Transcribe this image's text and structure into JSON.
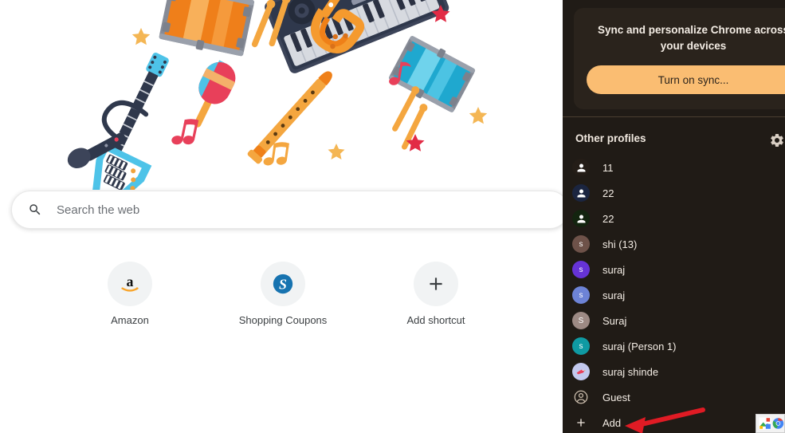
{
  "ntp": {
    "illustration_name": "musical-instruments-doodle",
    "search": {
      "placeholder": "Search the web",
      "value": "",
      "icon": "search-icon"
    },
    "shortcuts": [
      {
        "label": "Amazon",
        "icon": "amazon-icon"
      },
      {
        "label": "Shopping Coupons",
        "icon": "shopping-coupons-icon"
      },
      {
        "label": "Add shortcut",
        "icon": "plus-icon"
      }
    ]
  },
  "profile_panel": {
    "sync_card": {
      "title": "Sync and personalize Chrome across your devices",
      "button_label": "Turn on sync..."
    },
    "section_header": "Other profiles",
    "settings_icon": "gear-icon",
    "profiles": [
      {
        "name": "11",
        "initial": "",
        "avatar_type": "person-icon",
        "color": "#241d17"
      },
      {
        "name": "22",
        "initial": "",
        "avatar_type": "person-icon",
        "color": "#1b2540"
      },
      {
        "name": "22",
        "initial": "",
        "avatar_type": "person-icon",
        "color": "#13240f"
      },
      {
        "name": "shi (13)",
        "initial": "s",
        "avatar_type": "initial",
        "color": "#6e5249"
      },
      {
        "name": "suraj",
        "initial": "s",
        "avatar_type": "initial",
        "color": "#6633d6"
      },
      {
        "name": "suraj",
        "initial": "s",
        "avatar_type": "initial",
        "color": "#6d83d6"
      },
      {
        "name": "Suraj",
        "initial": "S",
        "avatar_type": "initial",
        "color": "#9d8a84"
      },
      {
        "name": "suraj (Person 1)",
        "initial": "s",
        "avatar_type": "initial",
        "color": "#0f9aa3"
      },
      {
        "name": "suraj shinde",
        "initial": "",
        "avatar_type": "bird-icon",
        "color": "#c3c9ee"
      },
      {
        "name": "Guest",
        "initial": "",
        "avatar_type": "guest-icon",
        "color": "transparent"
      },
      {
        "name": "Add",
        "initial": "",
        "avatar_type": "plus-icon",
        "color": "transparent"
      }
    ]
  },
  "annotation": {
    "arrow_color": "#e01b24",
    "arrow_target": "Add"
  },
  "corner_icons": [
    {
      "name": "photos-icon"
    },
    {
      "name": "chrome-icon"
    }
  ]
}
